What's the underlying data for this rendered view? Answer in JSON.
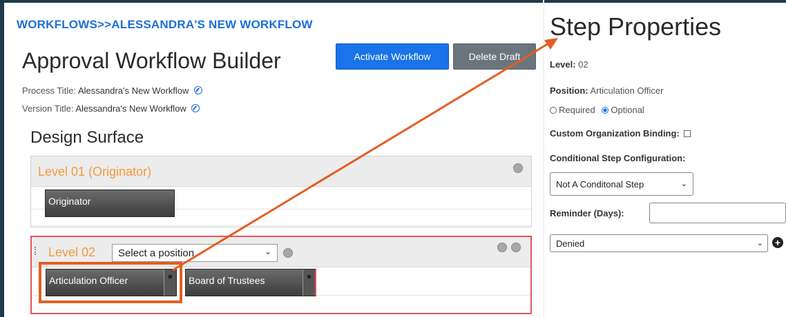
{
  "breadcrumb": "WORKFLOWS>>ALESSANDRA'S NEW WORKFLOW",
  "page_title": "Approval Workflow Builder",
  "buttons": {
    "activate": "Activate Workflow",
    "delete": "Delete Draft"
  },
  "meta": {
    "process_label": "Process Title:",
    "process_value": "Alessandra's New Workflow",
    "version_label": "Version Title:",
    "version_value": "Alessandra's New Workflow"
  },
  "design_surface": {
    "title": "Design Surface",
    "levels": [
      {
        "label": "Level 01 (Originator)",
        "positions": [
          "Originator"
        ]
      },
      {
        "label": "Level 02",
        "select_placeholder": "Select a position",
        "positions": [
          "Articulation Officer",
          "Board of Trustees"
        ]
      }
    ]
  },
  "step_properties": {
    "title": "Step Properties",
    "level_label": "Level:",
    "level_value": "02",
    "position_label": "Position:",
    "position_value": "Articulation Officer",
    "radio_required": "Required",
    "radio_optional": "Optional",
    "selected_radio": "Optional",
    "custom_org_label": "Custom Organization Binding:",
    "conditional_label": "Conditional Step Configuration:",
    "conditional_value": "Not A Conditonal Step",
    "reminder_label": "Reminder (Days):",
    "reminder_value": "",
    "denied_value": "Denied"
  },
  "colors": {
    "accent": "#1a73e8",
    "level_label": "#f39a3b",
    "highlight": "#e35e22",
    "selected_level_border": "#e2555b"
  },
  "icons": [
    "edit-icon",
    "add-circle-icon",
    "remove-circle-icon",
    "chevron-down-icon",
    "drag-handle-icon",
    "plus-icon"
  ]
}
